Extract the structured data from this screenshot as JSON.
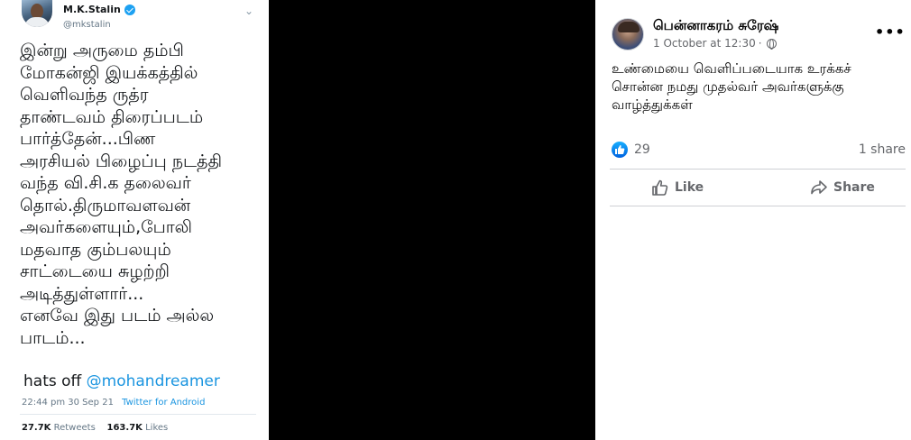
{
  "tweet": {
    "name": "M.K.Stalin",
    "handle": "@mkstalin",
    "lines": [
      "இன்று அருமை தம்பி",
      "மோகன்ஜி இயக்கத்தில்",
      "வெளிவந்த ருத்ர",
      "தாண்டவம் திரைப்படம்",
      "பார்த்தேன்...பிண",
      "அரசியல் பிழைப்பு நடத்தி",
      "வந்த வி.சி.க தலைவர்",
      "தொல்.திருமாவளவன்",
      "அவர்களையும்,போலி",
      "மதவாத கும்பலயும்",
      "சாட்டையை சுழற்றி",
      "அடித்துள்ளார்...",
      "எனவே இது படம் அல்ல",
      "பாடம்..."
    ],
    "hats_off": "hats off",
    "mention": "@mohandreamer",
    "time": "22:44 pm",
    "date": "30 Sep 21",
    "source": "Twitter for Android",
    "retweets_count": "27.7K",
    "retweets_label": "Retweets",
    "likes_count": "163.7K",
    "likes_label": "Likes"
  },
  "facebook": {
    "author": "பென்னாகரம் சுரேஷ்",
    "timestamp": "1 October at 12:30",
    "dot": "·",
    "text_lines": [
      "உண்மையை வெளிப்படையாக உரக்கச்",
      "சொன்ன நமது முதல்வர் அவர்களுக்கு",
      "வாழ்த்துக்கள்"
    ],
    "reaction_count": "29",
    "shares": "1 share",
    "like_label": "Like",
    "share_label": "Share",
    "more_glyph": "•••"
  },
  "colors": {
    "twitter_blue": "#1da1f2",
    "facebook_blue": "#1877f2",
    "background": "#000000"
  }
}
